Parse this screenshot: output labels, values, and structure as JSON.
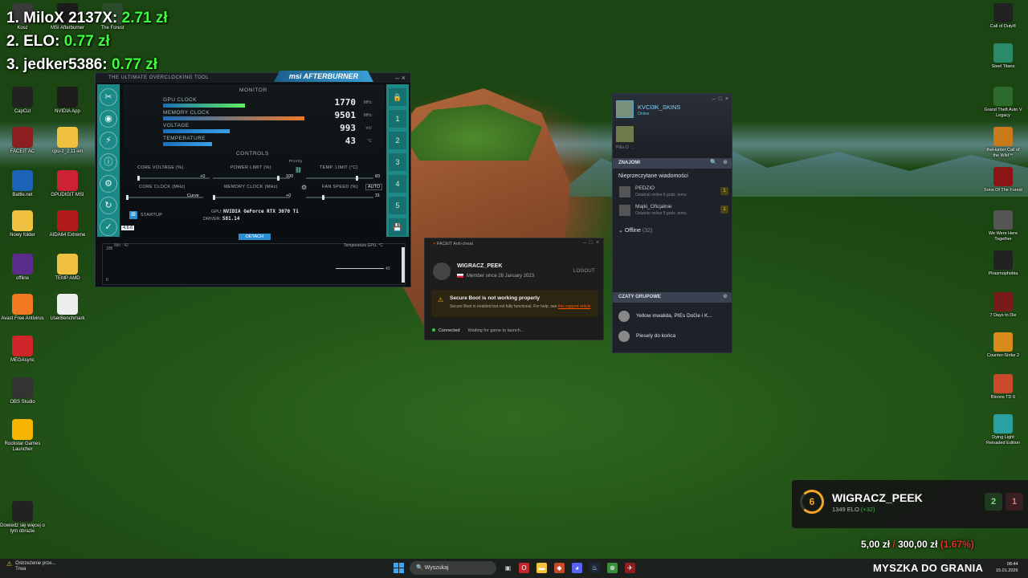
{
  "leaderboard": [
    {
      "rank_name": "1. MiloX 2137X: ",
      "amount": "2.71 zł"
    },
    {
      "rank_name": "2. ELO: ",
      "amount": "0.77 zł"
    },
    {
      "rank_name": "3. jedker5386: ",
      "amount": "0.77 zł"
    }
  ],
  "desktop_left": [
    {
      "label": "Kosz",
      "icon": "trash-icon"
    },
    {
      "label": "MSI Afterburner",
      "icon": "msi-icon"
    },
    {
      "label": "The Forest",
      "icon": "game-icon"
    },
    {
      "label": "CapCut",
      "icon": "capcut-icon"
    },
    {
      "label": "NVIDIA App",
      "icon": "nvidia-icon"
    },
    {
      "label": "FACEIT AC",
      "icon": "faceit-icon"
    },
    {
      "label": "cpu-z_2.11-en",
      "icon": "folder-icon"
    },
    {
      "label": "Battle.net",
      "icon": "battlenet-icon"
    },
    {
      "label": "GPUDIGIT MSI",
      "icon": "gpu-icon"
    },
    {
      "label": "Nowy folder",
      "icon": "folder-icon"
    },
    {
      "label": "AIDA64 Extreme",
      "icon": "aida64-icon"
    },
    {
      "label": "offline",
      "icon": "offline-icon"
    },
    {
      "label": "TEMP AMD",
      "icon": "folder-icon"
    },
    {
      "label": "Avast Free Antivirus",
      "icon": "avast-icon"
    },
    {
      "label": "UserBenchmark",
      "icon": "benchmark-icon"
    },
    {
      "label": "MEGAsync",
      "icon": "mega-icon"
    },
    {
      "label": "OBS Studio",
      "icon": "obs-icon"
    },
    {
      "label": "Rockstar Games Launcher",
      "icon": "rockstar-icon"
    },
    {
      "label": "Dowiedz się więcej o tym obrazie",
      "icon": "info-icon"
    }
  ],
  "desktop_right": [
    {
      "label": "Call of Duty®",
      "icon": "cod-icon"
    },
    {
      "label": "Steel Titans",
      "icon": "game-icon"
    },
    {
      "label": "Grand Theft Auto V Legacy",
      "icon": "gta-icon"
    },
    {
      "label": "theHunter Call of the Wild™",
      "icon": "hunter-icon"
    },
    {
      "label": "Sons Of The Forest",
      "icon": "sotf-icon"
    },
    {
      "label": "We Were Here Together",
      "icon": "game-icon"
    },
    {
      "label": "Phasmophobia",
      "icon": "phasmo-icon"
    },
    {
      "label": "7 Days to Die",
      "icon": "game-icon"
    },
    {
      "label": "Counter-Strike 2",
      "icon": "cs2-icon"
    },
    {
      "label": "Bloons TD 6",
      "icon": "bloons-icon"
    },
    {
      "label": "Dying Light Reloaded Edition",
      "icon": "dyinglight-icon"
    }
  ],
  "msi": {
    "title": "THE ULTIMATE OVERCLOCKING TOOL",
    "brand": "msi AFTERBURNER",
    "left_tools": [
      "✂",
      "◉",
      "⚡",
      "ⓘ",
      "⚙",
      "↻",
      "✓"
    ],
    "profiles": [
      "🔒",
      "1",
      "2",
      "3",
      "4",
      "5",
      "💾"
    ],
    "monitor_label": "MONITOR",
    "controls_label": "CONTROLS",
    "rows": [
      {
        "name": "GPU CLOCK",
        "value": "1770",
        "unit": "MHz",
        "fill": 0.55,
        "color": "#5ef05e"
      },
      {
        "name": "MEMORY CLOCK",
        "value": "9501",
        "unit": "MHz",
        "fill": 0.95,
        "color": "#f07a2a"
      },
      {
        "name": "VOLTAGE",
        "value": "993",
        "unit": "mV",
        "fill": 0.45,
        "color": "#3aa0e9"
      },
      {
        "name": "TEMPERATURE",
        "value": "43",
        "unit": "°C",
        "fill": 0.33,
        "color": "#3aa0e9"
      }
    ],
    "core_voltage": "CORE VOLTAGE (%)",
    "core_voltage_val": "+0",
    "power_limit": "POWER LIMIT (%)",
    "power_limit_val": "100",
    "temp_limit": "TEMP. LIMIT (°C)",
    "temp_limit_val": "83",
    "priority": "Priority",
    "core_clock": "CORE CLOCK (MHz)",
    "core_clock_val": "Curve",
    "memory_clock": "MEMORY CLOCK (MHz)",
    "memory_clock_val": "+0",
    "fan_speed": "FAN SPEED (%)",
    "fan_speed_val": "31",
    "fan_auto": "AUTO",
    "startup": "STARTUP",
    "version": "4.6.6",
    "gpu_label": "GPU:",
    "gpu_value": "NVIDIA GeForce RTX 3070 Ti",
    "driver_label": "DRIVER:",
    "driver_value": "581.14",
    "detach": "DETACH",
    "graph_top": "100",
    "graph_min": "Min : 42",
    "graph_title": "Temperatura GPU, °C",
    "graph_value": "43",
    "graph_bottom": "0"
  },
  "faceit": {
    "title": "FACEIT Anti-cheat",
    "username": "WIGRACZ_PEEK",
    "member": "Member since 28 January 2023",
    "logout": "LOGOUT",
    "warn_title": "Secure Boot is not working properly",
    "warn_text": "Secure Boot is enabled but not fully functional. For help, see ",
    "warn_link": "this support article",
    "status": "Connected",
    "waiting": "Waiting for game to launch..."
  },
  "steam": {
    "nick": "KVCI3K_SKINS",
    "status": "Online",
    "game": "PIEs D →",
    "friends_bar": "ZNAJOMI",
    "unread": "Nieprzeczytane wiadomości",
    "friends": [
      {
        "name": "PEDZIO",
        "status": "Ostatnio online 6 godz. temu",
        "count": "1"
      },
      {
        "name": "Majki_Oficjalnie",
        "status": "Ostatnio online 5 godz. temu",
        "count": "1"
      }
    ],
    "offline": "Offline",
    "offline_count": "(32)",
    "groups_bar": "CZATY GRUPOWE",
    "groups": [
      {
        "name": "Yellow inwalida, PIEs DoGe i K..."
      },
      {
        "name": "Piesely do końca"
      }
    ]
  },
  "faceit_widget": {
    "level": "6",
    "name": "WIGRACZ_PEEK",
    "elo": "1349 ELO",
    "elo_change": "(+32)",
    "wins": "2",
    "losses": "1"
  },
  "donation": {
    "current": "5,00 zł",
    "sep": "/",
    "goal": "300,00 zł",
    "extra": "(1.67%)"
  },
  "taskbar": {
    "warn_title": "Ostrzeżenie prze...",
    "warn_sub": "Trwa",
    "search": "Wyszukaj",
    "marquee": "MYSZKA DO GRANIA",
    "time": "08:44",
    "date": "15.01.2026"
  },
  "colors": {
    "accent_green": "#3cff3c",
    "msi_teal": "#1b8a87",
    "faceit_orange": "#ff5500",
    "steam_blue": "#8fd3ff"
  }
}
